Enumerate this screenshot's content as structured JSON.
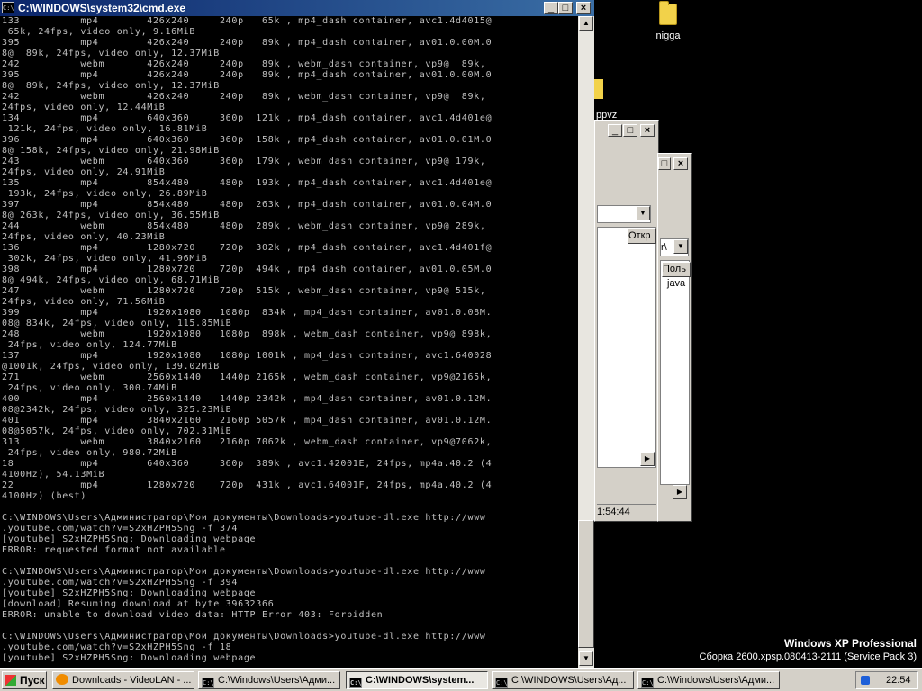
{
  "desktop": {
    "icon_label": "nigga",
    "partial_label": "ppvz",
    "os_name": "Windows XP Professional",
    "build": "Сборка 2600.xpsp.080413-2111 (Service Pack 3)"
  },
  "explorer1": {
    "column_label": "Откр",
    "statusbar_time": "1:54:44"
  },
  "explorer2": {
    "column_label": "Поль",
    "list_item": "java",
    "combo_value": "r\\"
  },
  "cmd": {
    "title": "C:\\WINDOWS\\system32\\cmd.exe",
    "output": "133          mp4        426x240     240p   65k , mp4_dash container, avc1.4d4015@\n 65k, 24fps, video only, 9.16MiB\n395          mp4        426x240     240p   89k , mp4_dash container, av01.0.00M.0\n8@  89k, 24fps, video only, 12.37MiB\n242          webm       426x240     240p   89k , webm_dash container, vp9@  89k,\n395          mp4        426x240     240p   89k , mp4_dash container, av01.0.00M.0\n8@  89k, 24fps, video only, 12.37MiB\n242          webm       426x240     240p   89k , webm_dash container, vp9@  89k,\n24fps, video only, 12.44MiB\n134          mp4        640x360     360p  121k , mp4_dash container, avc1.4d401e@\n 121k, 24fps, video only, 16.81MiB\n396          mp4        640x360     360p  158k , mp4_dash container, av01.0.01M.0\n8@ 158k, 24fps, video only, 21.98MiB\n243          webm       640x360     360p  179k , webm_dash container, vp9@ 179k,\n24fps, video only, 24.91MiB\n135          mp4        854x480     480p  193k , mp4_dash container, avc1.4d401e@\n 193k, 24fps, video only, 26.89MiB\n397          mp4        854x480     480p  263k , mp4_dash container, av01.0.04M.0\n8@ 263k, 24fps, video only, 36.55MiB\n244          webm       854x480     480p  289k , webm_dash container, vp9@ 289k,\n24fps, video only, 40.23MiB\n136          mp4        1280x720    720p  302k , mp4_dash container, avc1.4d401f@\n 302k, 24fps, video only, 41.96MiB\n398          mp4        1280x720    720p  494k , mp4_dash container, av01.0.05M.0\n8@ 494k, 24fps, video only, 68.71MiB\n247          webm       1280x720    720p  515k , webm_dash container, vp9@ 515k,\n24fps, video only, 71.56MiB\n399          mp4        1920x1080   1080p  834k , mp4_dash container, av01.0.08M.\n08@ 834k, 24fps, video only, 115.85MiB\n248          webm       1920x1080   1080p  898k , webm_dash container, vp9@ 898k,\n 24fps, video only, 124.77MiB\n137          mp4        1920x1080   1080p 1001k , mp4_dash container, avc1.640028\n@1001k, 24fps, video only, 139.02MiB\n271          webm       2560x1440   1440p 2165k , webm_dash container, vp9@2165k,\n 24fps, video only, 300.74MiB\n400          mp4        2560x1440   1440p 2342k , mp4_dash container, av01.0.12M.\n08@2342k, 24fps, video only, 325.23MiB\n401          mp4        3840x2160   2160p 5057k , mp4_dash container, av01.0.12M.\n08@5057k, 24fps, video only, 702.31MiB\n313          webm       3840x2160   2160p 7062k , webm_dash container, vp9@7062k,\n 24fps, video only, 980.72MiB\n18           mp4        640x360     360p  389k , avc1.42001E, 24fps, mp4a.40.2 (4\n4100Hz), 54.13MiB\n22           mp4        1280x720    720p  431k , avc1.64001F, 24fps, mp4a.40.2 (4\n4100Hz) (best)\n\nC:\\WINDOWS\\Users\\Администратор\\Мои документы\\Downloads>youtube-dl.exe http://www\n.youtube.com/watch?v=S2xHZPH5Sng -f 374\n[youtube] S2xHZPH5Sng: Downloading webpage\nERROR: requested format not available\n\nC:\\WINDOWS\\Users\\Администратор\\Мои документы\\Downloads>youtube-dl.exe http://www\n.youtube.com/watch?v=S2xHZPH5Sng -f 394\n[youtube] S2xHZPH5Sng: Downloading webpage\n[download] Resuming download at byte 39632366\nERROR: unable to download video data: HTTP Error 403: Forbidden\n\nC:\\WINDOWS\\Users\\Администратор\\Мои документы\\Downloads>youtube-dl.exe http://www\n.youtube.com/watch?v=S2xHZPH5Sng -f 18\n[youtube] S2xHZPH5Sng: Downloading webpage"
  },
  "taskbar": {
    "start_label": "Пуск",
    "buttons": [
      "Downloads - VideoLAN - ...",
      "C:\\Windows\\Users\\Адми...",
      "C:\\WINDOWS\\system...",
      "C:\\WINDOWS\\Users\\Ад...",
      "C:\\Windows\\Users\\Адми..."
    ],
    "clock": "22:54"
  },
  "colors": {
    "titlebar_active": "#0a246a",
    "console_text": "#c0c0c0",
    "console_bg": "#000000",
    "chrome_gray": "#d4d0c8"
  }
}
